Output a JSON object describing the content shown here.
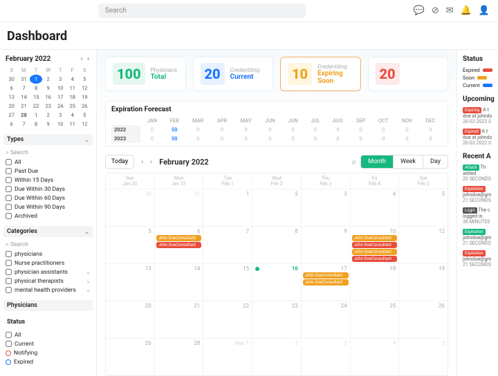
{
  "search_placeholder": "Search",
  "page_title": "Dashboard",
  "icons": [
    "chat-icon",
    "clock-icon",
    "mail-icon",
    "bell-icon",
    "user-icon"
  ],
  "minical": {
    "title": "February 2022",
    "dow": [
      "S",
      "M",
      "T",
      "W",
      "T",
      "F",
      "S"
    ],
    "weeks": [
      [
        30,
        31,
        1,
        2,
        3,
        4,
        5
      ],
      [
        6,
        7,
        8,
        9,
        10,
        11,
        12
      ],
      [
        13,
        14,
        15,
        16,
        17,
        18,
        19
      ],
      [
        20,
        21,
        22,
        23,
        24,
        25,
        26
      ],
      [
        27,
        28,
        1,
        2,
        3,
        4,
        5
      ],
      [
        6,
        7,
        8,
        9,
        10,
        11,
        12
      ]
    ],
    "selected": 1,
    "bold": [
      28
    ]
  },
  "filters": {
    "types_label": "Types",
    "categories_label": "Categories",
    "physicians_label": "Physicians",
    "status_label": "Status",
    "search_label": "Search",
    "types": [
      "All",
      "Past Due",
      "Within 15 Days",
      "Due Within 30 Days",
      "Due Within 60 Days",
      "Due Within 90 Days",
      "Archived"
    ],
    "categories": [
      "physicians",
      "Nurse practitioners",
      "physician assistants",
      "physical therapists",
      "mental health providers"
    ],
    "status": [
      "All",
      "Current",
      "Notifying",
      "Expired"
    ]
  },
  "cards": [
    {
      "n": "100",
      "lbl": "Physicians",
      "val": "Total",
      "c": "g"
    },
    {
      "n": "20",
      "lbl": "Credentiling",
      "val": "Current",
      "c": "b"
    },
    {
      "n": "10",
      "lbl": "Credentiling",
      "val": "Expiring Soon",
      "c": "y"
    },
    {
      "n": "20",
      "lbl": "",
      "val": "",
      "c": "r"
    }
  ],
  "forecast": {
    "title": "Expiration Forecast",
    "months": [
      "JAN",
      "FEB",
      "MAR",
      "APR",
      "MAY",
      "JUN",
      "JUN",
      "JUL",
      "AUG",
      "SEP",
      "OCT",
      "NOV",
      "DEC"
    ],
    "rows": [
      {
        "y": "2022",
        "v": [
          0,
          50,
          0,
          0,
          0,
          0,
          0,
          0,
          0,
          0,
          0,
          0,
          0
        ]
      },
      {
        "y": "2023",
        "v": [
          0,
          50,
          0,
          0,
          0,
          0,
          0,
          0,
          0,
          0,
          0,
          0,
          0
        ]
      }
    ]
  },
  "calctrl": {
    "today": "Today",
    "title": "February 2022",
    "views": [
      "Month",
      "Week",
      "Day"
    ],
    "active": "Month"
  },
  "caldow": [
    "Sun",
    "Mon",
    "Tue",
    "Wed",
    "Thu",
    "Fri",
    "Sat"
  ],
  "caldow_sub": [
    "Jan 30",
    "Jan 31",
    "Feb 1",
    "Feb 2",
    "Feb 3",
    "Feb 4",
    "Feb 5"
  ],
  "weeks": [
    {
      "days": [
        30,
        31,
        1,
        2,
        3,
        4,
        5
      ],
      "out": [
        0,
        1
      ]
    },
    {
      "days": [
        5,
        6,
        7,
        8,
        9,
        10,
        12
      ],
      "ev": {
        "1": [
          "y",
          "r"
        ],
        "5": [
          "y",
          "r",
          "y",
          "r"
        ]
      }
    },
    {
      "days": [
        13,
        14,
        15,
        16,
        17,
        18,
        19
      ],
      "today": 3,
      "ev": {
        "4": [
          "y",
          "y"
        ]
      }
    },
    {
      "days": [
        20,
        21,
        22,
        23,
        24,
        25,
        26
      ]
    },
    {
      "days": [
        26,
        28,
        1,
        2,
        3,
        4,
        5
      ],
      "out": [
        2,
        3,
        4,
        5,
        6
      ],
      "outlabel": {
        "2": "Mar 1"
      }
    }
  ],
  "evtext": "John DoeConsultant",
  "status": {
    "title": "Status",
    "items": [
      {
        "c": "r",
        "l": "Expired"
      },
      {
        "c": "y",
        "l": "Soon"
      },
      {
        "c": "b",
        "l": "Current"
      }
    ]
  },
  "upcoming": {
    "title": "Upcoming",
    "items": [
      {
        "tag": "Expiring",
        "tc": "r",
        "l1": "A t",
        "l2": "doe at johndo",
        "l3": "26-02-2022 0"
      },
      {
        "tag": "Expired",
        "tc": "r",
        "l1": "A t",
        "l2": "doe at johndo",
        "l3": "26-02-2022 0"
      }
    ]
  },
  "recent": {
    "title": "Recent A",
    "items": [
      {
        "tag": "Attach",
        "tc": "g",
        "l1": "Th",
        "l2": "added",
        "l3": "20 SECONDS"
      },
      {
        "tag": "Expiration",
        "tc": "r",
        "l1": "",
        "l2": "johndoe@gm",
        "l3": "21 SECONDS"
      },
      {
        "tag": "Login",
        "tc": "d",
        "l1": "The c",
        "l2": "logged in",
        "l3": "38 MINUTES"
      },
      {
        "tag": "Expiration",
        "tc": "g",
        "l1": "",
        "l2": "johndoe@gm",
        "l3": "21 SECONDS"
      },
      {
        "tag": "Expiration",
        "tc": "r",
        "l1": "",
        "l2": "johndoe@gm",
        "l3": "21 SECONDS"
      }
    ]
  }
}
